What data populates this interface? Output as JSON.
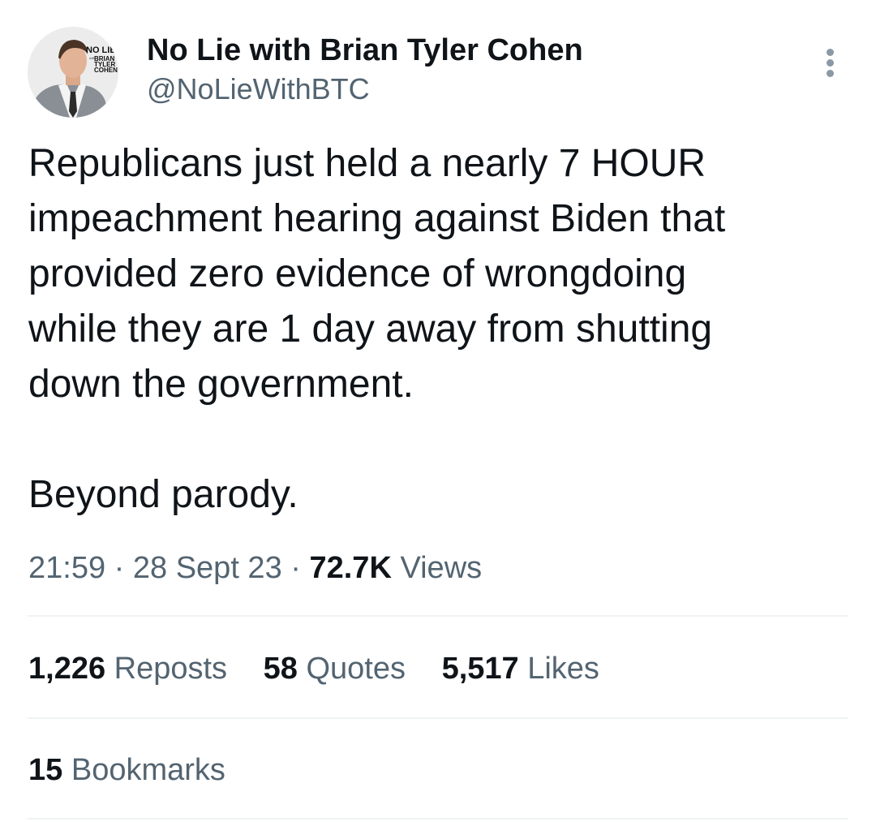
{
  "author": {
    "avatar_logo_text": [
      "NO LIE",
      "with",
      "BRIAN",
      "TYLER",
      "COHEN"
    ],
    "display_name": "No Lie with Brian Tyler Cohen",
    "handle": "@NoLieWithBTC",
    "more_icon": "more-dots-vertical-icon"
  },
  "tweet": {
    "text": "Republicans just held a nearly 7 HOUR\nimpeachment hearing against Biden that\nprovided zero evidence of wrongdoing\nwhile they are 1 day away from shutting\ndown the government.\n\nBeyond parody."
  },
  "meta": {
    "time": "21:59",
    "separator": "·",
    "date": "28 Sept 23",
    "views_count": "72.7K",
    "views_label": "Views"
  },
  "stats": {
    "reposts_count": "1,226",
    "reposts_label": "Reposts",
    "quotes_count": "58",
    "quotes_label": "Quotes",
    "likes_count": "5,517",
    "likes_label": "Likes",
    "bookmarks_count": "15",
    "bookmarks_label": "Bookmarks"
  },
  "colors": {
    "text_primary": "#0f1419",
    "text_secondary": "#536471",
    "divider": "#eff3f4",
    "more_dots": "#8b98a5"
  }
}
